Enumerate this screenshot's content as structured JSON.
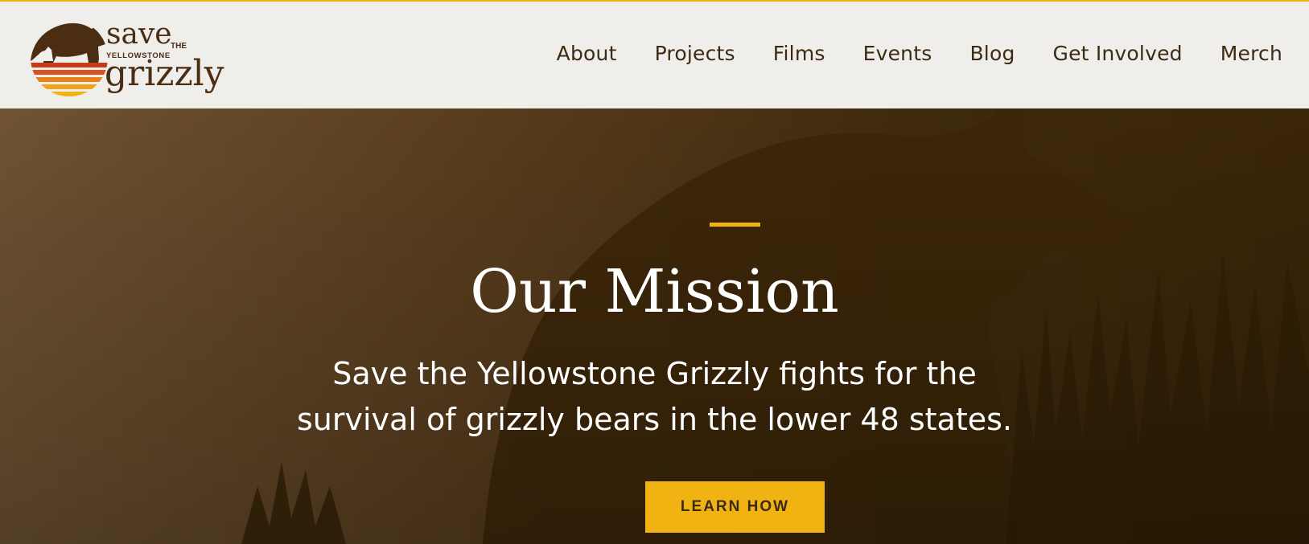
{
  "logo": {
    "word1": "save",
    "word2": "THE",
    "word3": "YELLOWSTONE",
    "word4": "grizzly"
  },
  "nav": {
    "items": [
      "About",
      "Projects",
      "Films",
      "Events",
      "Blog",
      "Get Involved",
      "Merch"
    ]
  },
  "hero": {
    "title": "Our Mission",
    "description": "Save the Yellowstone Grizzly fights for the survival of grizzly bears in the lower 48 states.",
    "cta_label": "LEARN HOW"
  },
  "colors": {
    "accent": "#f0b311",
    "brown": "#3c2a12",
    "header_bg": "#efeeeb",
    "hero_bg": "#3d2808"
  }
}
